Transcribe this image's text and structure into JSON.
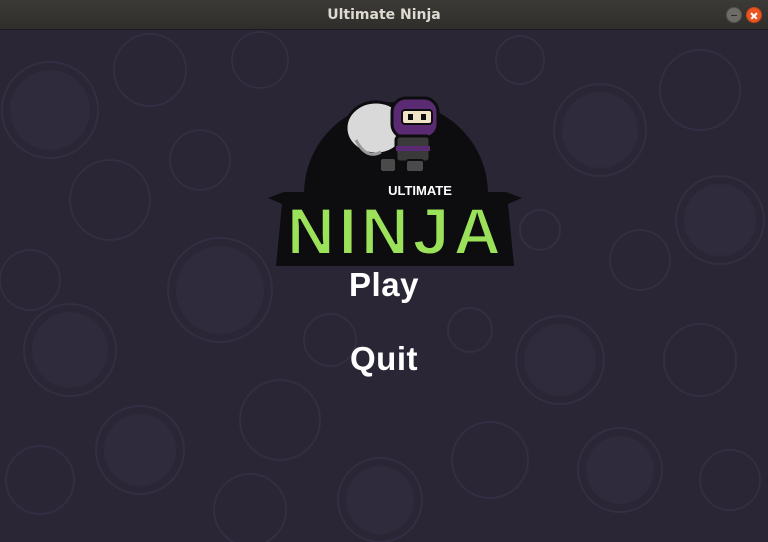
{
  "window": {
    "title": "Ultimate Ninja"
  },
  "logo": {
    "small_text": "ULTIMATE",
    "big_text": "NINJA",
    "accent_color": "#9be25a",
    "outline_color": "#0d0d0f"
  },
  "menu": {
    "play_label": "Play",
    "quit_label": "Quit"
  },
  "colors": {
    "background": "#2a2636",
    "bubble": "#322d40",
    "close_button": "#e95420"
  }
}
